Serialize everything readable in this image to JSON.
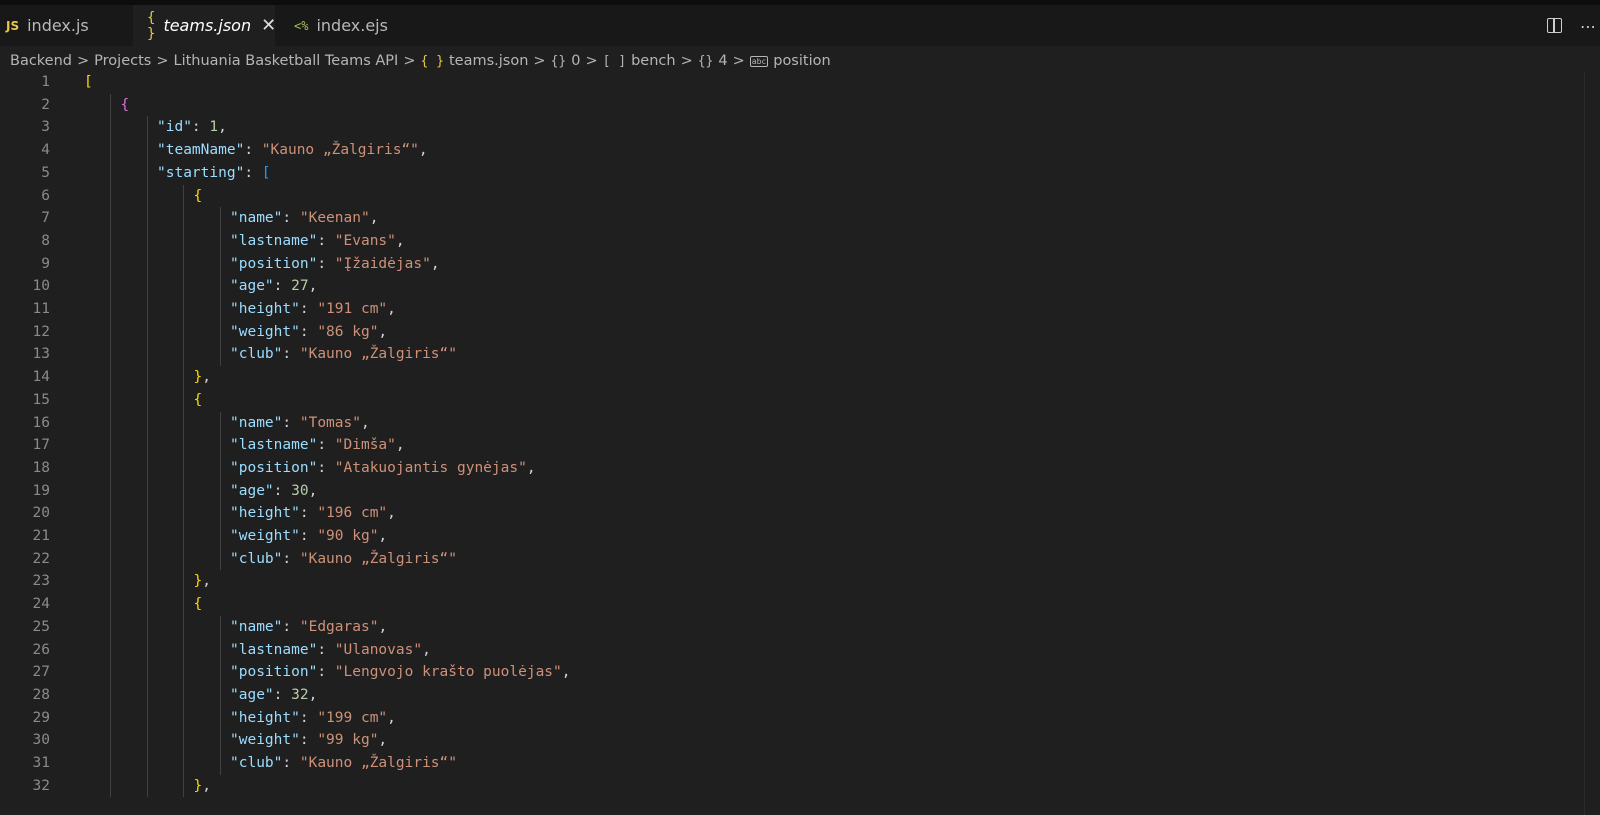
{
  "tabs": [
    {
      "icon_text": "JS",
      "icon": "javascript-file-icon",
      "label": "index.js"
    },
    {
      "icon_text": "{ }",
      "icon": "json-file-icon",
      "label": "teams.json",
      "active": true,
      "close": "✕"
    },
    {
      "icon_text": "<%",
      "icon": "ejs-file-icon",
      "label": "index.ejs"
    }
  ],
  "breadcrumb": {
    "items": [
      {
        "label": "Backend"
      },
      {
        "label": "Projects"
      },
      {
        "label": "Lithuania Basketball Teams API"
      },
      {
        "icon_text": "{ }",
        "label": "teams.json"
      },
      {
        "icon_text": "{}",
        "label": "0"
      },
      {
        "icon_text": "[ ]",
        "label": "bench"
      },
      {
        "icon_text": "{}",
        "label": "4"
      },
      {
        "icon_text": "abc",
        "label": "position"
      }
    ],
    "separator": ">"
  },
  "editor": {
    "lines": [
      [
        [
          "b1",
          "["
        ]
      ],
      [
        [
          "b2",
          "{"
        ]
      ],
      [
        [
          "k",
          "\"id\""
        ],
        [
          "p",
          ": "
        ],
        [
          "n",
          "1"
        ],
        [
          "p",
          ","
        ]
      ],
      [
        [
          "k",
          "\"teamName\""
        ],
        [
          "p",
          ": "
        ],
        [
          "s",
          "\"Kauno „Žalgiris“\""
        ],
        [
          "p",
          ","
        ]
      ],
      [
        [
          "k",
          "\"starting\""
        ],
        [
          "p",
          ": "
        ],
        [
          "b3",
          "["
        ]
      ],
      [
        [
          "b1",
          "{"
        ]
      ],
      [
        [
          "k",
          "\"name\""
        ],
        [
          "p",
          ": "
        ],
        [
          "s",
          "\"Keenan\""
        ],
        [
          "p",
          ","
        ]
      ],
      [
        [
          "k",
          "\"lastname\""
        ],
        [
          "p",
          ": "
        ],
        [
          "s",
          "\"Evans\""
        ],
        [
          "p",
          ","
        ]
      ],
      [
        [
          "k",
          "\"position\""
        ],
        [
          "p",
          ": "
        ],
        [
          "s",
          "\"Įžaidėjas\""
        ],
        [
          "p",
          ","
        ]
      ],
      [
        [
          "k",
          "\"age\""
        ],
        [
          "p",
          ": "
        ],
        [
          "n",
          "27"
        ],
        [
          "p",
          ","
        ]
      ],
      [
        [
          "k",
          "\"height\""
        ],
        [
          "p",
          ": "
        ],
        [
          "s",
          "\"191 cm\""
        ],
        [
          "p",
          ","
        ]
      ],
      [
        [
          "k",
          "\"weight\""
        ],
        [
          "p",
          ": "
        ],
        [
          "s",
          "\"86 kg\""
        ],
        [
          "p",
          ","
        ]
      ],
      [
        [
          "k",
          "\"club\""
        ],
        [
          "p",
          ": "
        ],
        [
          "s",
          "\"Kauno „Žalgiris“\""
        ]
      ],
      [
        [
          "b1",
          "}"
        ],
        [
          "p",
          ","
        ]
      ],
      [
        [
          "b1",
          "{"
        ]
      ],
      [
        [
          "k",
          "\"name\""
        ],
        [
          "p",
          ": "
        ],
        [
          "s",
          "\"Tomas\""
        ],
        [
          "p",
          ","
        ]
      ],
      [
        [
          "k",
          "\"lastname\""
        ],
        [
          "p",
          ": "
        ],
        [
          "s",
          "\"Dimša\""
        ],
        [
          "p",
          ","
        ]
      ],
      [
        [
          "k",
          "\"position\""
        ],
        [
          "p",
          ": "
        ],
        [
          "s",
          "\"Atakuojantis gynėjas\""
        ],
        [
          "p",
          ","
        ]
      ],
      [
        [
          "k",
          "\"age\""
        ],
        [
          "p",
          ": "
        ],
        [
          "n",
          "30"
        ],
        [
          "p",
          ","
        ]
      ],
      [
        [
          "k",
          "\"height\""
        ],
        [
          "p",
          ": "
        ],
        [
          "s",
          "\"196 cm\""
        ],
        [
          "p",
          ","
        ]
      ],
      [
        [
          "k",
          "\"weight\""
        ],
        [
          "p",
          ": "
        ],
        [
          "s",
          "\"90 kg\""
        ],
        [
          "p",
          ","
        ]
      ],
      [
        [
          "k",
          "\"club\""
        ],
        [
          "p",
          ": "
        ],
        [
          "s",
          "\"Kauno „Žalgiris“\""
        ]
      ],
      [
        [
          "b1",
          "}"
        ],
        [
          "p",
          ","
        ]
      ],
      [
        [
          "b1",
          "{"
        ]
      ],
      [
        [
          "k",
          "\"name\""
        ],
        [
          "p",
          ": "
        ],
        [
          "s",
          "\"Edgaras\""
        ],
        [
          "p",
          ","
        ]
      ],
      [
        [
          "k",
          "\"lastname\""
        ],
        [
          "p",
          ": "
        ],
        [
          "s",
          "\"Ulanovas\""
        ],
        [
          "p",
          ","
        ]
      ],
      [
        [
          "k",
          "\"position\""
        ],
        [
          "p",
          ": "
        ],
        [
          "s",
          "\"Lengvojo krašto puolėjas\""
        ],
        [
          "p",
          ","
        ]
      ],
      [
        [
          "k",
          "\"age\""
        ],
        [
          "p",
          ": "
        ],
        [
          "n",
          "32"
        ],
        [
          "p",
          ","
        ]
      ],
      [
        [
          "k",
          "\"height\""
        ],
        [
          "p",
          ": "
        ],
        [
          "s",
          "\"199 cm\""
        ],
        [
          "p",
          ","
        ]
      ],
      [
        [
          "k",
          "\"weight\""
        ],
        [
          "p",
          ": "
        ],
        [
          "s",
          "\"99 kg\""
        ],
        [
          "p",
          ","
        ]
      ],
      [
        [
          "k",
          "\"club\""
        ],
        [
          "p",
          ": "
        ],
        [
          "s",
          "\"Kauno „Žalgiris“\""
        ]
      ],
      [
        [
          "b1",
          "}"
        ],
        [
          "p",
          ","
        ]
      ]
    ]
  },
  "colors": {
    "background": "#1f1f1f",
    "key": "#9cdcfe",
    "string": "#ce9178",
    "number": "#b5cea8",
    "bracket_gold": "#ffd700",
    "bracket_purple": "#da70d6",
    "bracket_blue": "#179fff"
  }
}
